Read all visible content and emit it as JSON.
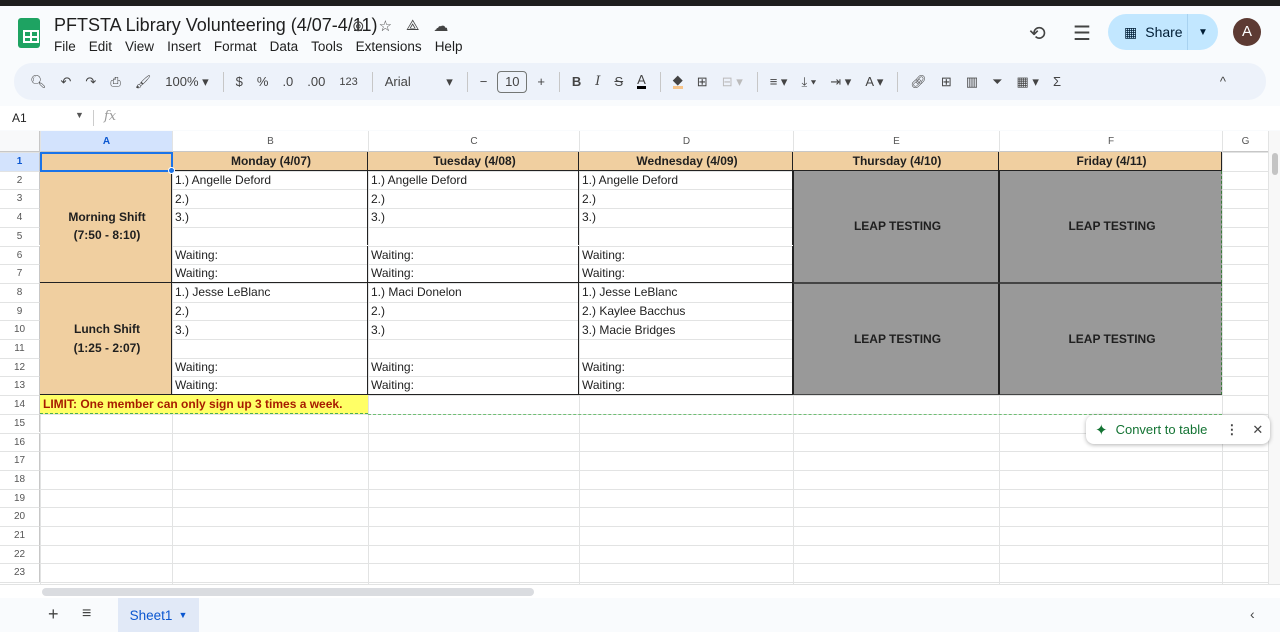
{
  "app": {
    "title": "PFTSTA Library Volunteering (4/07-4/11)",
    "menu": [
      "File",
      "Edit",
      "View",
      "Insert",
      "Format",
      "Data",
      "Tools",
      "Extensions",
      "Help"
    ],
    "share_label": "Share",
    "avatar_letter": "A"
  },
  "toolbar": {
    "zoom": "100%",
    "currency": "$",
    "percent": "%",
    "dec_decrease": ".0",
    "dec_increase": ".00",
    "number_format": "123",
    "font": "Arial",
    "font_size": "10",
    "bold": "B",
    "italic": "I",
    "sum": "Σ"
  },
  "formula_bar": {
    "name_box": "A1",
    "fx": "fx",
    "value": ""
  },
  "colors": {
    "header_fill": "#f0cfa0",
    "leap_fill": "#999999",
    "limit_fill": "#ffff66",
    "limit_text": "#a61c00"
  },
  "sheet": {
    "columns": [
      "A",
      "B",
      "C",
      "D",
      "E",
      "F",
      "G"
    ],
    "row_numbers": [
      "1",
      "2",
      "3",
      "4",
      "5",
      "6",
      "7",
      "8",
      "9",
      "10",
      "11",
      "12",
      "13",
      "14",
      "15",
      "16",
      "17",
      "18",
      "19",
      "20",
      "21",
      "22",
      "23"
    ],
    "headers": [
      "Monday (4/07)",
      "Tuesday (4/08)",
      "Wednesday (4/09)",
      "Thursday (4/10)",
      "Friday (4/11)"
    ],
    "morning_label": "Morning Shift",
    "morning_time": "(7:50 - 8:10)",
    "lunch_label": "Lunch Shift",
    "lunch_time": "(1:25 - 2:07)",
    "morning": [
      [
        "1.) Angelle Deford",
        "2.)",
        "3.)",
        "",
        "Waiting:",
        "Waiting:"
      ],
      [
        "1.) Angelle Deford",
        "2.)",
        "3.)",
        "",
        "Waiting:",
        "Waiting:"
      ],
      [
        "1.) Angelle Deford",
        "2.)",
        "3.)",
        "",
        "Waiting:",
        "Waiting:"
      ]
    ],
    "lunch": [
      [
        "1.) Jesse LeBlanc",
        "2.)",
        "3.)",
        "",
        "Waiting:",
        "Waiting:"
      ],
      [
        "1.)  Maci Donelon",
        "2.)",
        "3.)",
        "",
        "Waiting:",
        "Waiting:"
      ],
      [
        "1.) Jesse LeBlanc",
        "2.) Kaylee Bacchus",
        "3.) Macie Bridges",
        "",
        "Waiting:",
        "Waiting:"
      ]
    ],
    "leap": "LEAP TESTING",
    "limit": "LIMIT: One member can only sign up 3 times a week."
  },
  "convert": {
    "label": "Convert to table"
  },
  "tabs": {
    "active": "Sheet1"
  }
}
